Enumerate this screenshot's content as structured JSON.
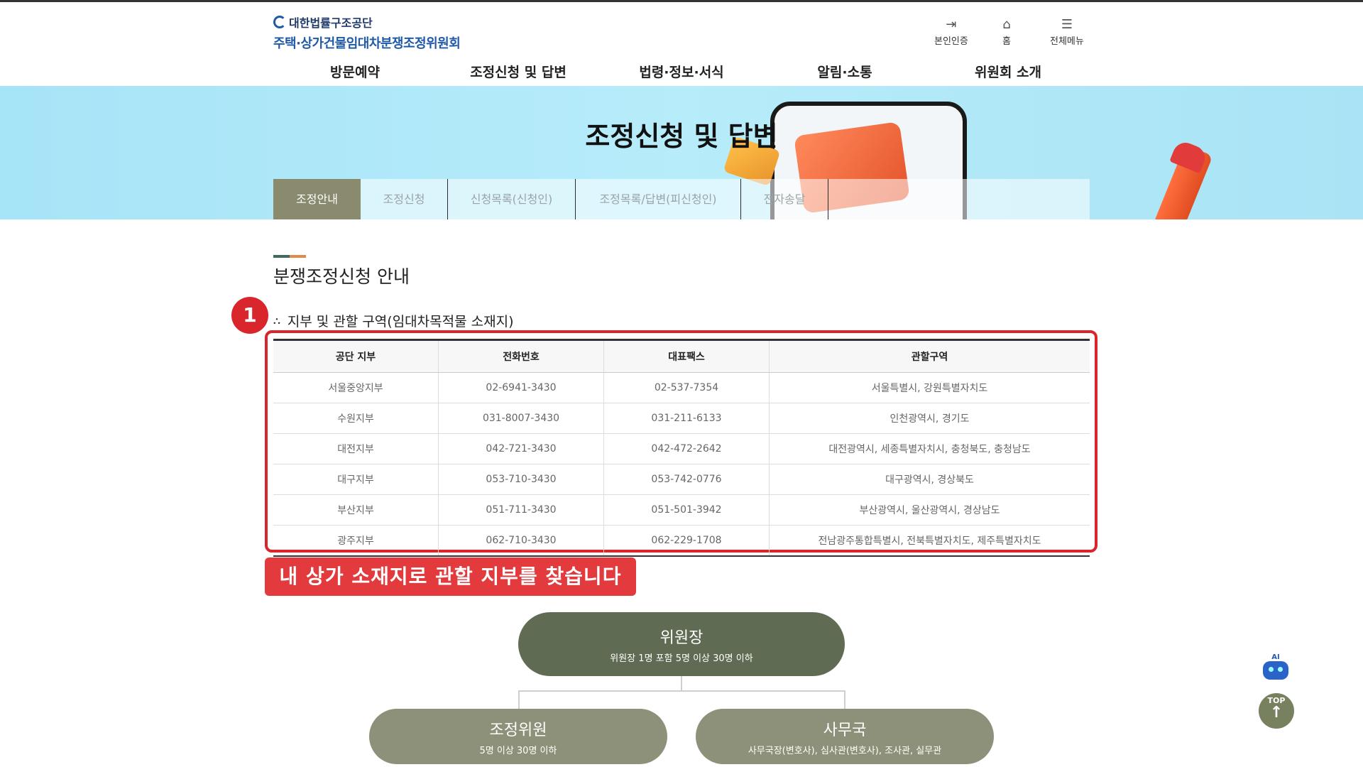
{
  "header": {
    "org_name": "대한법률구조공단",
    "site_name": "주택·상가건물임대차분쟁조정위원회",
    "utils": [
      {
        "label": "본인인증",
        "icon": "login-icon"
      },
      {
        "label": "홈",
        "icon": "home-icon"
      },
      {
        "label": "전체메뉴",
        "icon": "menu-icon"
      }
    ]
  },
  "gnb": [
    "방문예약",
    "조정신청 및 답변",
    "법령·정보·서식",
    "알림·소통",
    "위원회 소개"
  ],
  "banner": {
    "title": "조정신청 및 답변"
  },
  "tabs": [
    "조정안내",
    "조정신청",
    "신청목록(신청인)",
    "조정목록/답변(피신청인)",
    "전자송달"
  ],
  "active_tab": "조정안내",
  "section": {
    "title": "분쟁조정신청 안내",
    "step_number": "1",
    "subtitle": "지부 및 관할 구역(임대차목적물 소재지)"
  },
  "branch_table": {
    "headers": [
      "공단 지부",
      "전화번호",
      "대표팩스",
      "관할구역"
    ],
    "rows": [
      [
        "서울중앙지부",
        "02-6941-3430",
        "02-537-7354",
        "서울특별시, 강원특별자치도"
      ],
      [
        "수원지부",
        "031-8007-3430",
        "031-211-6133",
        "인천광역시, 경기도"
      ],
      [
        "대전지부",
        "042-721-3430",
        "042-472-2642",
        "대전광역시, 세종특별자치시, 충청북도, 충청남도"
      ],
      [
        "대구지부",
        "053-710-3430",
        "053-742-0776",
        "대구광역시, 경상북도"
      ],
      [
        "부산지부",
        "051-711-3430",
        "051-501-3942",
        "부산광역시, 울산광역시, 경상남도"
      ],
      [
        "광주지부",
        "062-710-3430",
        "062-229-1708",
        "전남광주통합특별시, 전북특별자치도, 제주특별자치도"
      ]
    ]
  },
  "callout": "내 상가 소재지로 관할 지부를 찾습니다",
  "org_chart": {
    "chair": {
      "title": "위원장",
      "desc": "위원장 1명 포함 5명 이상 30명 이하"
    },
    "mediator": {
      "title": "조정위원",
      "desc": "5명 이상 30명 이하"
    },
    "office": {
      "title": "사무국",
      "desc": "사무국장(변호사), 심사관(변호사), 조사관, 실무관"
    }
  },
  "floating": {
    "ai_label": "AI",
    "top_label": "TOP"
  },
  "colors": {
    "accent_red": "#d9262d",
    "tab_active": "#8a8a6e",
    "org_dark": "#5f6b52",
    "org_light": "#8d9179"
  }
}
